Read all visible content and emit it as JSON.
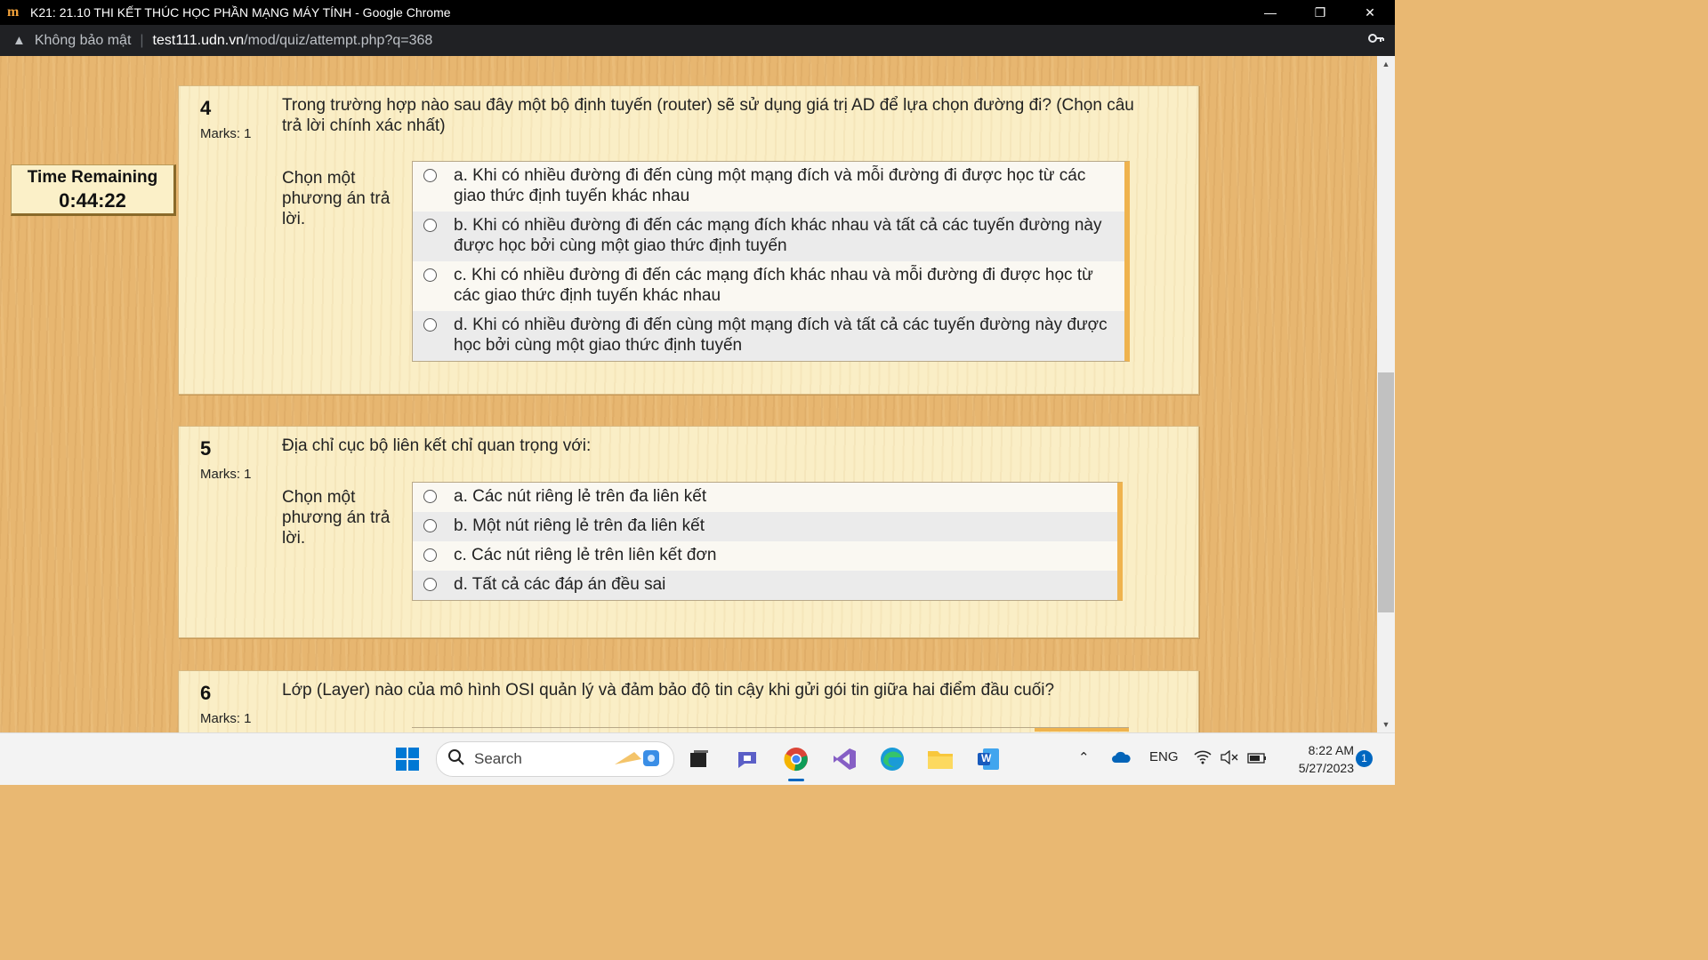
{
  "window": {
    "title": "K21: 21.10 THI KẾT THÚC HỌC PHẦN MẠNG MÁY TÍNH - Google Chrome",
    "logo": "m",
    "controls": [
      "—",
      "❐",
      "✕"
    ]
  },
  "addressbar": {
    "security_label": "Không bảo mật",
    "url_host": "test111.udn.vn",
    "url_path": "/mod/quiz/attempt.php?q=368"
  },
  "timer": {
    "label": "Time Remaining",
    "value": "0:44:22"
  },
  "questions": [
    {
      "number": "4",
      "marks": "Marks: 1",
      "text": "Trong trường hợp nào sau đây một bộ định tuyến (router) sẽ sử dụng giá trị AD để lựa chọn đường đi? (Chọn câu trả lời chính xác nhất)",
      "prompt": "Chọn một phương án trả lời.",
      "options": [
        "a. Khi có nhiều đường đi đến cùng một mạng đích và mỗi đường đi được học từ các giao thức định tuyến khác nhau",
        "b. Khi có nhiều đường đi đến các mạng đích khác nhau và tất cả các tuyến đường này được học bởi cùng một giao thức định tuyến",
        "c. Khi có nhiều đường đi đến các mạng đích khác nhau và mỗi đường đi được học từ các giao thức định tuyến khác nhau",
        "d. Khi có nhiều đường đi đến cùng một mạng đích và tất cả các tuyến đường này được học bởi cùng một giao thức định tuyến"
      ]
    },
    {
      "number": "5",
      "marks": "Marks: 1",
      "text": "Địa chỉ cục bộ liên kết chỉ quan trọng với:",
      "prompt": "Chọn một phương án trả lời.",
      "options": [
        "a. Các nút riêng lẻ trên đa liên kết",
        "b. Một nút riêng lẻ trên đa liên kết",
        "c. Các nút riêng lẻ trên liên kết đơn",
        "d. Tất cả các đáp án đều sai"
      ]
    },
    {
      "number": "6",
      "marks": "Marks: 1",
      "text": "Lớp (Layer) nào của mô hình OSI quản lý và đảm bảo độ tin cậy khi gửi gói tin giữa hai điểm đầu cuối?"
    }
  ],
  "taskbar": {
    "search_placeholder": "Search",
    "language": "ENG",
    "time": "8:22 AM",
    "date": "5/27/2023",
    "notification_count": "1",
    "word_letter": "W"
  }
}
